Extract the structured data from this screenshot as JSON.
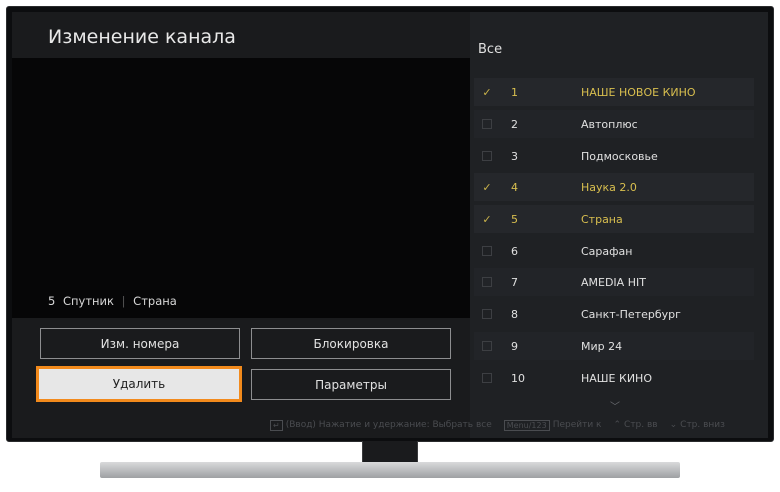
{
  "screen": {
    "title": "Изменение канала",
    "preview_info": {
      "number": "5",
      "source": "Спутник",
      "channel": "Страна"
    }
  },
  "buttons": {
    "edit_number": "Изм. номера",
    "lock": "Блокировка",
    "delete": "Удалить",
    "params": "Параметры"
  },
  "list": {
    "header": "Все",
    "channels": [
      {
        "num": "1",
        "name": "НАШЕ НОВОЕ КИНО",
        "checked": true
      },
      {
        "num": "2",
        "name": "Автоплюс",
        "checked": false
      },
      {
        "num": "3",
        "name": "Подмосковье",
        "checked": false
      },
      {
        "num": "4",
        "name": "Наука 2.0",
        "checked": true
      },
      {
        "num": "5",
        "name": "Страна",
        "checked": true
      },
      {
        "num": "6",
        "name": "Сарафан",
        "checked": false
      },
      {
        "num": "7",
        "name": "AMEDIA HIT",
        "checked": false
      },
      {
        "num": "8",
        "name": "Санкт-Петербург",
        "checked": false
      },
      {
        "num": "9",
        "name": "Мир 24",
        "checked": false
      },
      {
        "num": "10",
        "name": "НАШЕ КИНО",
        "checked": false
      }
    ],
    "more_icon": "chevron-down-icon"
  },
  "hints": {
    "enter": "(Ввод) Нажатие и удержание: Выбрать все",
    "menu_key": "Menu/123",
    "goto": "Перейти к",
    "page_up": "Стр. вв",
    "page_down": "Стр. вниз"
  },
  "colors": {
    "focus_border": "#f28a1c",
    "selected_text": "#d9bf4f"
  }
}
